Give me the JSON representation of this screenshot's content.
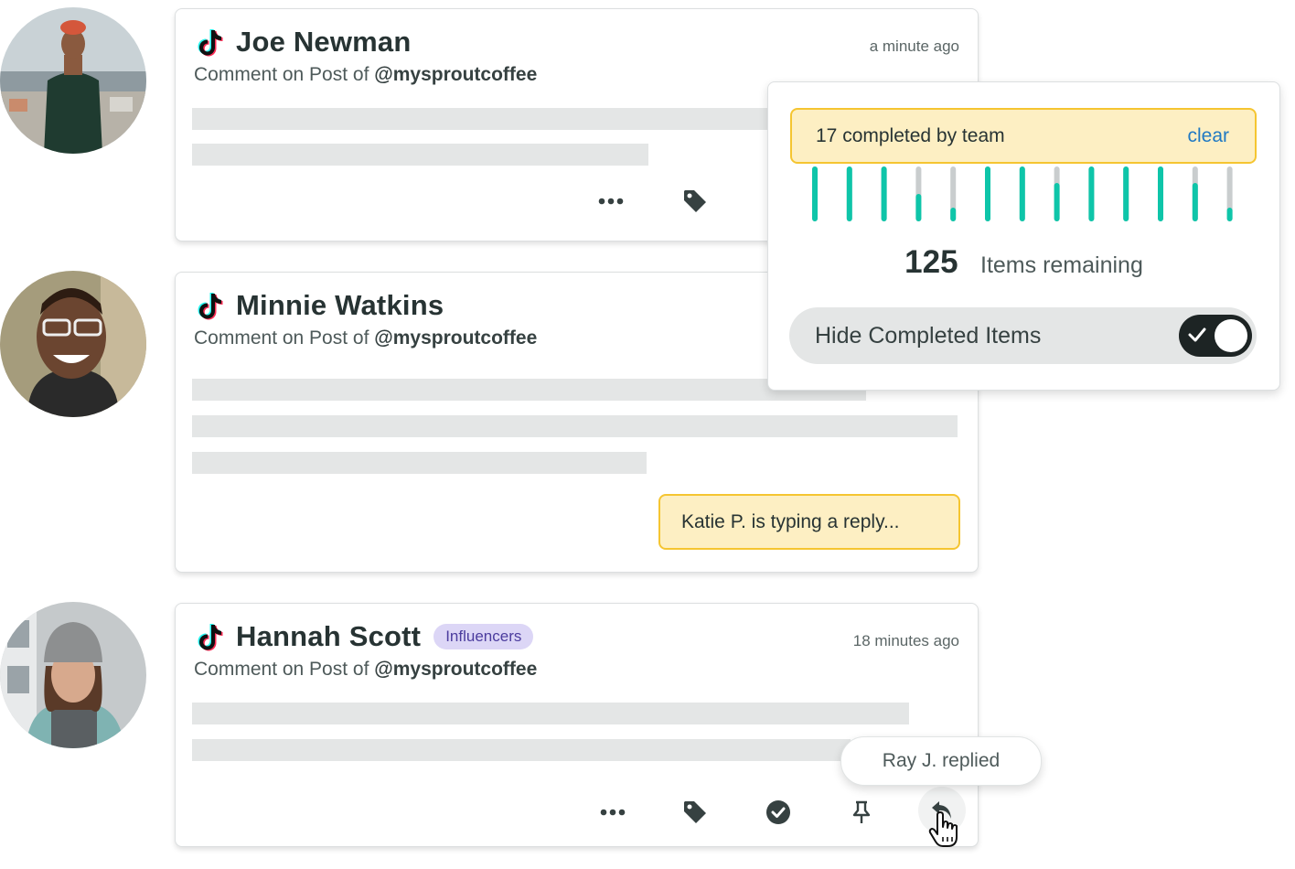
{
  "cards": [
    {
      "name": "Joe Newman",
      "time": "a minute ago",
      "subtitle_prefix": "Comment on Post of",
      "handle": "@mysproutcoffee"
    },
    {
      "name": "Minnie Watkins",
      "subtitle_prefix": "Comment on Post of",
      "handle": "@mysproutcoffee",
      "typing": "Katie P. is typing a reply..."
    },
    {
      "name": "Hannah Scott",
      "badge": "Influencers",
      "time": "18 minutes ago",
      "subtitle_prefix": "Comment on Post of",
      "handle": "@mysproutcoffee",
      "replied": "Ray J. replied"
    }
  ],
  "panel": {
    "banner": "17 completed by team",
    "clear": "clear",
    "progress": [
      1,
      1,
      1,
      0.5,
      0.25,
      1,
      1,
      0.7,
      1,
      1,
      1,
      0.7,
      0.25
    ],
    "remaining_count": "125",
    "remaining_label": "Items remaining",
    "toggle_label": "Hide Completed Items",
    "toggle_on": true
  },
  "colors": {
    "accent": "#0ec5a9",
    "highlight_bg": "#fdefc3",
    "highlight_border": "#f5c531",
    "link": "#2079c3"
  },
  "icons": [
    "tiktok-icon",
    "more-icon",
    "tag-icon",
    "complete-icon",
    "pin-icon",
    "reply-icon",
    "hand-cursor-icon",
    "check-icon"
  ]
}
